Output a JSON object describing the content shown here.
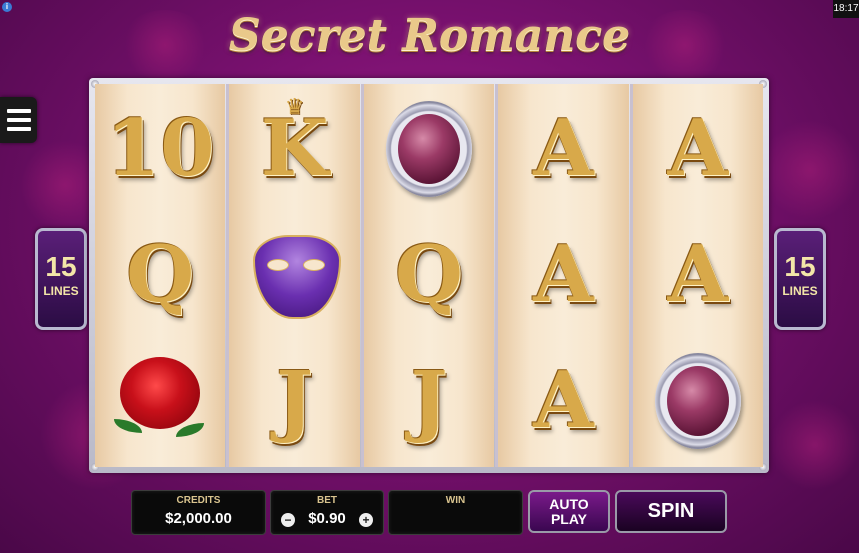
{
  "status": {
    "clock": "18:17",
    "info_icon": "i"
  },
  "game": {
    "title": "Secret Romance"
  },
  "lines": {
    "left_count": "15",
    "left_label": "LINES",
    "right_count": "15",
    "right_label": "LINES"
  },
  "reels": [
    [
      "10",
      "Q",
      "rose"
    ],
    [
      "K",
      "mask",
      "J"
    ],
    [
      "gem",
      "Q",
      "J"
    ],
    [
      "A",
      "A",
      "A"
    ],
    [
      "A",
      "A",
      "gem"
    ]
  ],
  "controls": {
    "credits_label": "CREDITS",
    "credits_value": "$2,000.00",
    "bet_label": "BET",
    "bet_value": "$0.90",
    "bet_minus": "−",
    "bet_plus": "+",
    "win_label": "WIN",
    "win_value": "",
    "autoplay_line1": "AUTO",
    "autoplay_line2": "PLAY",
    "spin_label": "SPIN"
  },
  "icons": [
    "menu-icon",
    "info-icon"
  ],
  "colors": {
    "gold": "#d8a94a",
    "background": "#7a1170",
    "reel_bg": "#f7e6cd"
  }
}
